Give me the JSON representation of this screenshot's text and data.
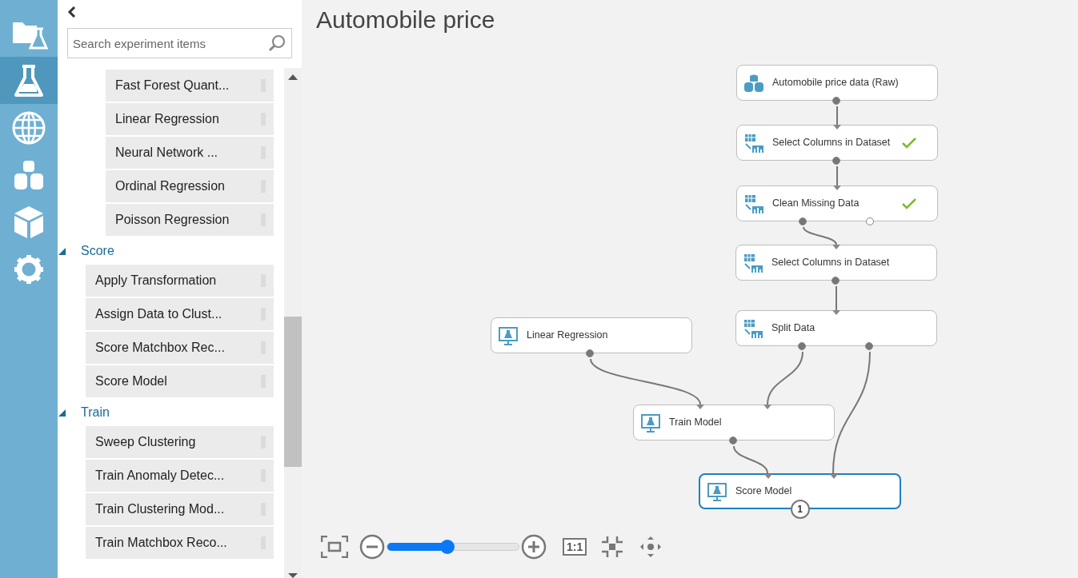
{
  "rail": [
    {
      "selected": false
    },
    {
      "selected": true
    },
    {
      "selected": false
    },
    {
      "selected": false
    },
    {
      "selected": false
    },
    {
      "selected": false
    }
  ],
  "palette": {
    "search": {
      "placeholder": "Search experiment items"
    },
    "tree": [
      {
        "children": [
          {
            "children": [
              {
                "label": "Fast Forest Quant..."
              },
              {
                "label": "Linear Regression"
              },
              {
                "label": "Neural Network ..."
              },
              {
                "label": "Ordinal Regression"
              },
              {
                "label": "Poisson Regression"
              }
            ]
          }
        ]
      },
      {
        "title": "Score",
        "expanded": true,
        "children": [
          {
            "label": "Apply Transformation"
          },
          {
            "label": "Assign Data to Clust..."
          },
          {
            "label": "Score Matchbox Rec..."
          },
          {
            "label": "Score Model"
          }
        ]
      },
      {
        "title": "Train",
        "expanded": true,
        "children": [
          {
            "label": "Sweep Clustering"
          },
          {
            "label": "Train Anomaly Detec..."
          },
          {
            "label": "Train Clustering Mod..."
          },
          {
            "label": "Train Matchbox Reco..."
          }
        ]
      }
    ]
  },
  "experiment": {
    "title": "Automobile price",
    "nodes": [
      {
        "label": "Automobile price data (Raw)",
        "kind": "dataset",
        "done": false,
        "selected": false,
        "outputs": [
          {
            "connected": true
          }
        ]
      },
      {
        "label": "Select Columns in Dataset",
        "kind": "module",
        "done": true,
        "selected": false,
        "outputs": [
          {
            "connected": true
          }
        ]
      },
      {
        "label": "Clean Missing Data",
        "kind": "module",
        "done": true,
        "selected": false,
        "outputs": [
          {
            "connected": true
          },
          {
            "connected": false
          }
        ]
      },
      {
        "label": "Select Columns in Dataset",
        "kind": "module",
        "done": false,
        "selected": false,
        "outputs": [
          {
            "connected": true
          }
        ]
      },
      {
        "label": "Split Data",
        "kind": "module",
        "done": false,
        "selected": false,
        "outputs": [
          {
            "connected": true
          },
          {
            "connected": true
          }
        ]
      },
      {
        "label": "Linear Regression",
        "kind": "model",
        "done": false,
        "selected": false,
        "outputs": [
          {
            "connected": true
          }
        ]
      },
      {
        "label": "Train Model",
        "kind": "model",
        "done": false,
        "selected": false,
        "outputs": [
          {
            "connected": true
          }
        ]
      },
      {
        "label": "Score Model",
        "kind": "model",
        "done": false,
        "selected": true,
        "badge": "1"
      }
    ]
  },
  "zoom": {
    "level": 0.46,
    "actual_size": "1:1"
  }
}
